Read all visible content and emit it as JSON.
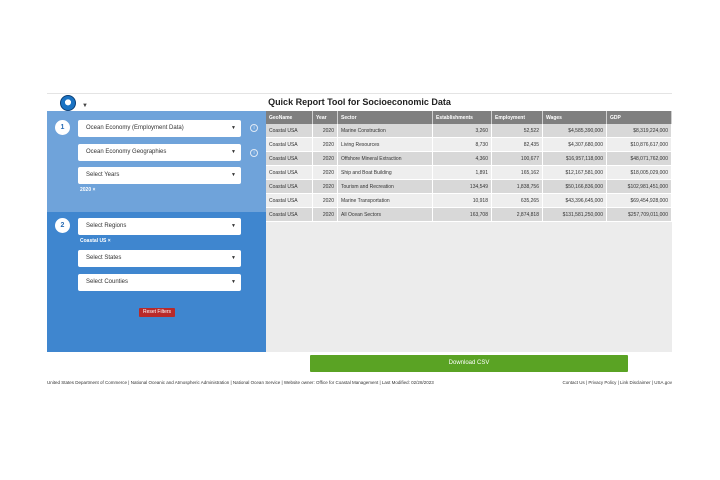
{
  "header": {
    "title": "Quick Report Tool for Socioeconomic Data"
  },
  "filters": {
    "step1_number": "1",
    "dataset_select": "Ocean Economy (Employment Data)",
    "geographies_select": "Ocean Economy Geographies",
    "years_select": "Select Years",
    "year_chip": "2020 ×",
    "step2_number": "2",
    "regions_select": "Select Regions",
    "region_chip": "Coastal US ×",
    "states_select": "Select States",
    "counties_select": "Select Counties",
    "reset_label": "Reset Filters",
    "info_glyph": "i",
    "caret_glyph": "▼"
  },
  "table": {
    "columns": [
      "GeoName",
      "Year",
      "Sector",
      "Establishments",
      "Employment",
      "Wages",
      "GDP"
    ],
    "rows": [
      [
        "Coastal USA",
        "2020",
        "Marine Construction",
        "3,260",
        "52,522",
        "$4,585,390,000",
        "$8,319,224,000"
      ],
      [
        "Coastal USA",
        "2020",
        "Living Resources",
        "8,730",
        "82,435",
        "$4,307,680,000",
        "$10,876,617,000"
      ],
      [
        "Coastal USA",
        "2020",
        "Offshore Mineral Extraction",
        "4,360",
        "100,677",
        "$16,957,118,000",
        "$48,071,762,000"
      ],
      [
        "Coastal USA",
        "2020",
        "Ship and Boat Building",
        "1,891",
        "165,162",
        "$12,167,581,000",
        "$18,005,029,000"
      ],
      [
        "Coastal USA",
        "2020",
        "Tourism and Recreation",
        "134,549",
        "1,838,756",
        "$50,166,836,000",
        "$102,981,451,000"
      ],
      [
        "Coastal USA",
        "2020",
        "Marine Transportation",
        "10,918",
        "635,265",
        "$43,396,645,000",
        "$69,454,928,000"
      ],
      [
        "Coastal USA",
        "2020",
        "All Ocean Sectors",
        "163,708",
        "2,874,818",
        "$131,581,250,000",
        "$257,709,011,000"
      ]
    ]
  },
  "download_label": "Download CSV",
  "footer": {
    "left": "United States Department of Commerce | National Oceanic and Atmospheric Administration | National Ocean Service | Website owner: Office for Coastal Management | Last Modified: 02/28/2023",
    "right": "Contact Us | Privacy Policy | Link Disclaimer | USA.gov"
  }
}
